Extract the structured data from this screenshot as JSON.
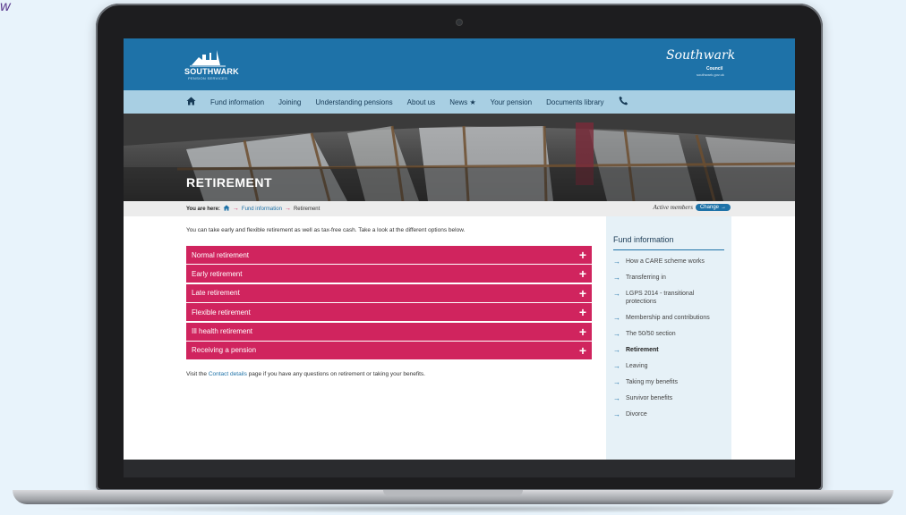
{
  "corner_glyph": "w",
  "header": {
    "logo_title": "SOUTHWARK",
    "logo_subtitle": "PENSION SERVICES",
    "council_script": "Southwark",
    "council_word": "Council",
    "council_url": "southwark.gov.uk",
    "brand_color": "#1e72a8"
  },
  "nav": {
    "home_icon": "home-icon",
    "items": [
      "Fund information",
      "Joining",
      "Understanding pensions",
      "About us",
      "News",
      "Your pension",
      "Documents library"
    ],
    "star_glyph": "★",
    "phone_icon": "phone-icon"
  },
  "hero": {
    "title": "RETIREMENT"
  },
  "breadcrumb": {
    "prefix": "You are here:",
    "link": "Fund information",
    "current": "Retirement",
    "members_label": "Active members",
    "change_label": "Change"
  },
  "main": {
    "intro": "You can take early and flexible retirement as well as tax-free cash. Take a look at the different options below.",
    "accordion": [
      "Normal retirement",
      "Early retirement",
      "Late retirement",
      "Flexible retirement",
      "Ill health retirement",
      "Receiving a pension"
    ],
    "accent_color": "#d0245e",
    "outro_before": "Visit the",
    "outro_link": "Contact details",
    "outro_after": "page if you have any questions on retirement or taking your benefits."
  },
  "sidebar": {
    "title": "Fund information",
    "items": [
      "How a CARE scheme works",
      "Transferring in",
      "LGPS 2014 - transitional protections",
      "Membership and contributions",
      "The 50/50 section",
      "Retirement",
      "Leaving",
      "Taking my benefits",
      "Survivor benefits",
      "Divorce"
    ],
    "active": "Retirement"
  }
}
